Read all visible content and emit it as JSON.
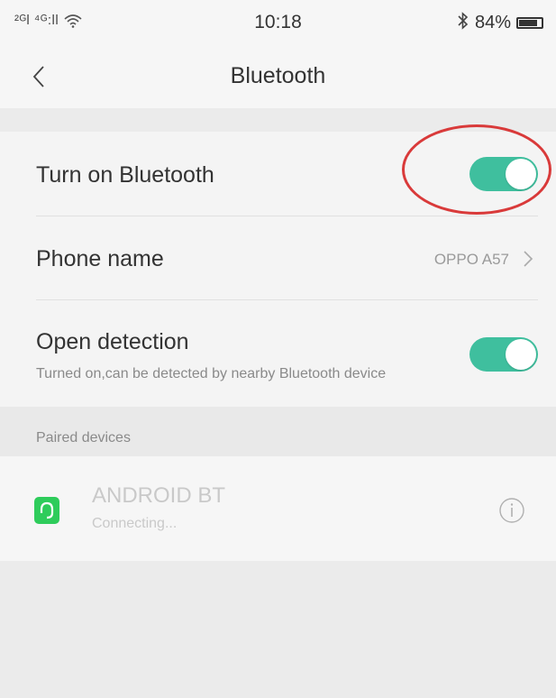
{
  "status_bar": {
    "signal_text": "²ᴳl ⁴ᴳ:ll",
    "time": "10:18",
    "battery_text": "84%",
    "battery_level": 0.84
  },
  "header": {
    "title": "Bluetooth"
  },
  "settings": {
    "bluetooth": {
      "label": "Turn on Bluetooth",
      "enabled": true
    },
    "phone_name": {
      "label": "Phone name",
      "value": "OPPO A57"
    },
    "open_detection": {
      "label": "Open detection",
      "subtitle": "Turned on,can be detected by nearby Bluetooth device",
      "enabled": true
    }
  },
  "paired": {
    "section_label": "Paired devices",
    "devices": [
      {
        "name": "ANDROID BT",
        "status": "Connecting..."
      }
    ]
  },
  "colors": {
    "toggle_on": "#3fbf9e",
    "highlight": "#d93a3a",
    "device_icon": "#2ecc5b"
  },
  "icons": {
    "back": "back-chevron-icon",
    "phone_chevron": "chevron-right-icon",
    "device": "headset-icon",
    "info": "info-icon",
    "wifi": "wifi-icon",
    "bluetooth_status": "bluetooth-icon",
    "battery": "battery-icon"
  }
}
